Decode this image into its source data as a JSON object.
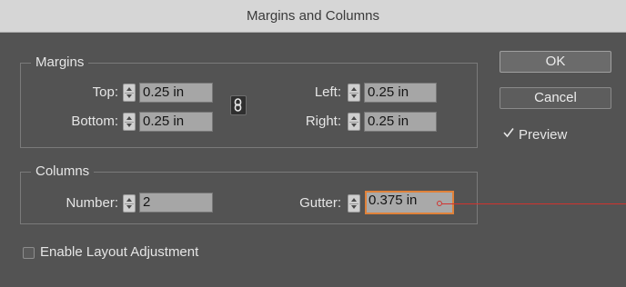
{
  "window": {
    "title": "Margins and Columns"
  },
  "margins": {
    "label": "Margins",
    "top": {
      "label": "Top:",
      "value": "0.25 in"
    },
    "bottom": {
      "label": "Bottom:",
      "value": "0.25 in"
    },
    "left": {
      "label": "Left:",
      "value": "0.25 in"
    },
    "right": {
      "label": "Right:",
      "value": "0.25 in"
    },
    "link_icon": "chain-link-icon"
  },
  "columns": {
    "label": "Columns",
    "number": {
      "label": "Number:",
      "value": "2"
    },
    "gutter": {
      "label": "Gutter:",
      "value": "0.375 in"
    }
  },
  "buttons": {
    "ok": "OK",
    "cancel": "Cancel"
  },
  "preview": {
    "label": "Preview",
    "checked": true
  },
  "layout_adjustment": {
    "label": "Enable Layout Adjustment",
    "checked": false
  },
  "colors": {
    "focus": "#e0823a",
    "annotation": "#d0332f"
  }
}
